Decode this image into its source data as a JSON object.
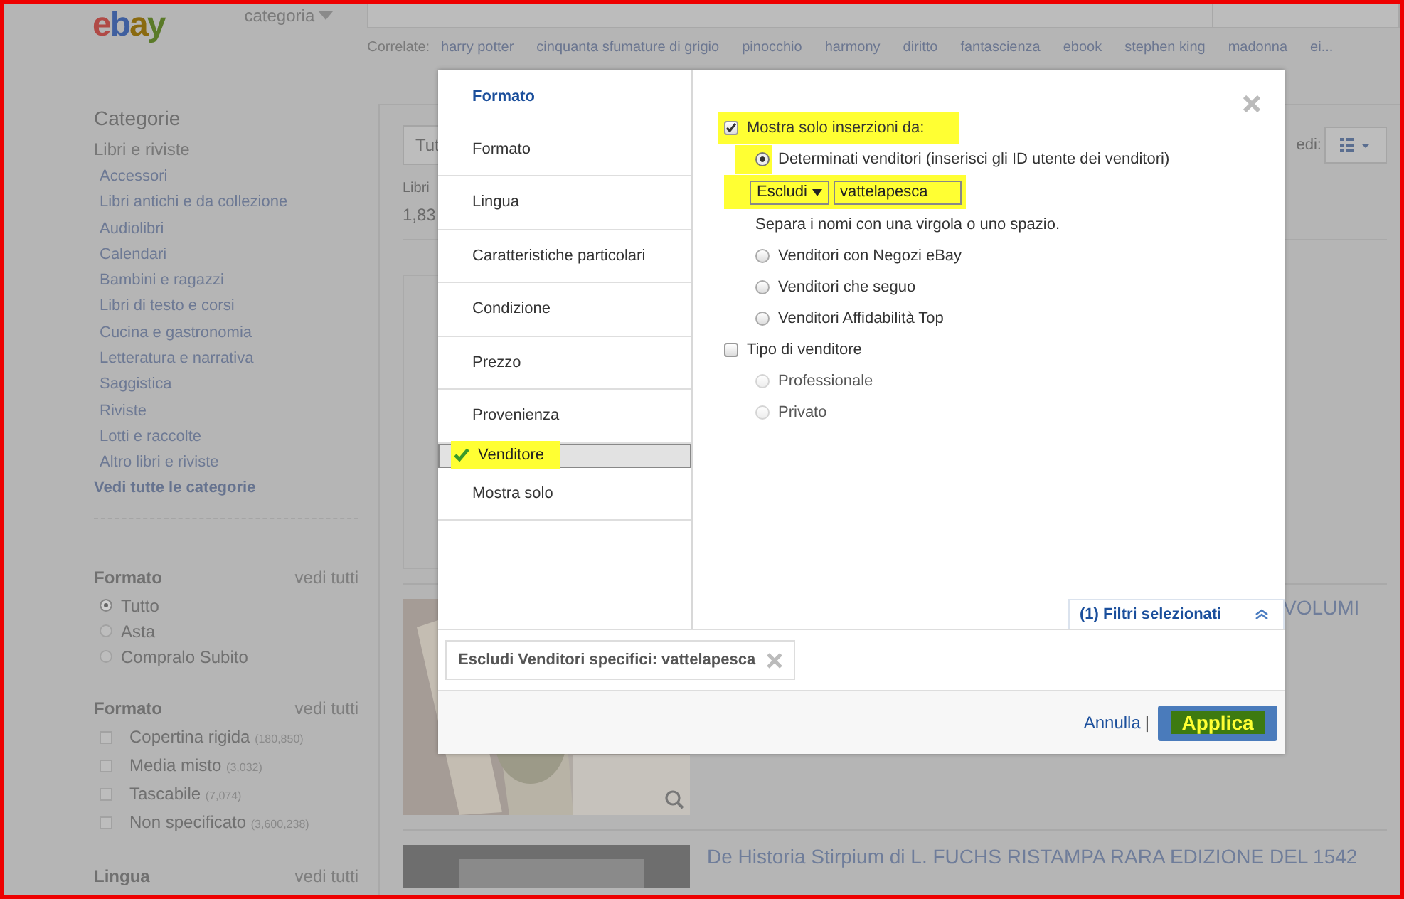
{
  "header": {
    "logo": "ebay",
    "category_button": "categoria",
    "related_label": "Correlate:",
    "related": [
      "harry potter",
      "cinquanta sfumature di grigio",
      "pinocchio",
      "harmony",
      "diritto",
      "fantascienza",
      "ebook",
      "stephen king",
      "madonna",
      "ei..."
    ]
  },
  "sidebar": {
    "title": "Categorie",
    "category": "Libri e riviste",
    "subcategories": [
      "Accessori",
      "Libri antichi e da collezione",
      "Audiolibri",
      "Calendari",
      "Bambini e ragazzi",
      "Libri di testo e corsi",
      "Cucina e gastronomia",
      "Letteratura e narrativa",
      "Saggistica",
      "Riviste",
      "Lotti e raccolte",
      "Altro libri e riviste"
    ],
    "see_all": "Vedi tutte le categorie",
    "groups": [
      {
        "kind": "radio",
        "title": "Formato",
        "see_all": "vedi tutti",
        "options": [
          {
            "label": "Tutto",
            "selected": true
          },
          {
            "label": "Asta",
            "selected": false
          },
          {
            "label": "Compralo Subito",
            "selected": false
          }
        ]
      },
      {
        "kind": "checkbox",
        "title": "Formato",
        "see_all": "vedi tutti",
        "options": [
          {
            "label": "Copertina rigida",
            "count": "(180,850)",
            "checked": false
          },
          {
            "label": "Media misto",
            "count": "(3,032)",
            "checked": false
          },
          {
            "label": "Tascabile",
            "count": "(7,074)",
            "checked": false
          },
          {
            "label": "Non specificato",
            "count": "(3,600,238)",
            "checked": false
          }
        ]
      },
      {
        "kind": "heading",
        "title": "Lingua",
        "see_all": "vedi tutti"
      }
    ]
  },
  "main": {
    "sort_button": "Tut",
    "view_label": "edi:",
    "breadcrumb": "Libri",
    "result_count": "1,83",
    "listings": [
      {
        "title": "VOLUMI",
        "kind": "picture"
      },
      {
        "title": "De Historia Stirpium di L. FUCHS RISTAMPA RARA EDIZIONE DEL 1542",
        "kind": "picture"
      }
    ]
  },
  "dialog": {
    "nav": [
      {
        "label": "Formato",
        "kind": "title",
        "selected": false,
        "checked": false,
        "highlighted": false
      },
      {
        "label": "Formato",
        "kind": "item",
        "selected": false,
        "checked": false,
        "highlighted": false
      },
      {
        "label": "Lingua",
        "kind": "item",
        "selected": false,
        "checked": false,
        "highlighted": false
      },
      {
        "label": "Caratteristiche particolari",
        "kind": "item",
        "selected": false,
        "checked": false,
        "highlighted": false
      },
      {
        "label": "Condizione",
        "kind": "item",
        "selected": false,
        "checked": false,
        "highlighted": false
      },
      {
        "label": "Prezzo",
        "kind": "item",
        "selected": false,
        "checked": false,
        "highlighted": false
      },
      {
        "label": "Provenienza",
        "kind": "item",
        "selected": false,
        "checked": false,
        "highlighted": false
      },
      {
        "label": "Venditore",
        "kind": "item",
        "selected": true,
        "checked": true,
        "highlighted": true
      },
      {
        "label": "Mostra solo",
        "kind": "item",
        "selected": false,
        "checked": false,
        "highlighted": false
      }
    ],
    "options": [
      {
        "kind": "checkbox",
        "label": "Mostra solo inserzioni da:",
        "checked": true,
        "disabled": false,
        "highlighted": true
      },
      {
        "kind": "radio",
        "label": "Determinati venditori (inserisci gli ID utente dei venditori)",
        "selected": true,
        "disabled": false,
        "highlighted": true
      },
      {
        "kind": "seller-input",
        "select": "Escludi",
        "value": "vattelapesca",
        "highlighted": true
      },
      {
        "kind": "hint",
        "label": "Separa i nomi con una virgola o uno spazio."
      },
      {
        "kind": "radio",
        "label": "Venditori con Negozi eBay",
        "selected": false,
        "disabled": false,
        "highlighted": false
      },
      {
        "kind": "radio",
        "label": "Venditori che seguo",
        "selected": false,
        "disabled": false,
        "highlighted": false
      },
      {
        "kind": "radio",
        "label": "Venditori Affidabilità Top",
        "selected": false,
        "disabled": false,
        "highlighted": false
      },
      {
        "kind": "checkbox",
        "label": "Tipo di venditore",
        "checked": false,
        "disabled": false,
        "highlighted": false
      },
      {
        "kind": "radio",
        "label": "Professionale",
        "selected": false,
        "disabled": true,
        "highlighted": false
      },
      {
        "kind": "radio",
        "label": "Privato",
        "selected": false,
        "disabled": true,
        "highlighted": false
      }
    ],
    "selected_filters_tab": "(1) Filtri selezionati",
    "selected_filters_expanded": true,
    "chips": [
      "Escludi Venditori specifici: vattelapesca"
    ],
    "cancel": "Annulla",
    "separator": "|",
    "apply": "Applica",
    "apply_highlighted": true
  }
}
